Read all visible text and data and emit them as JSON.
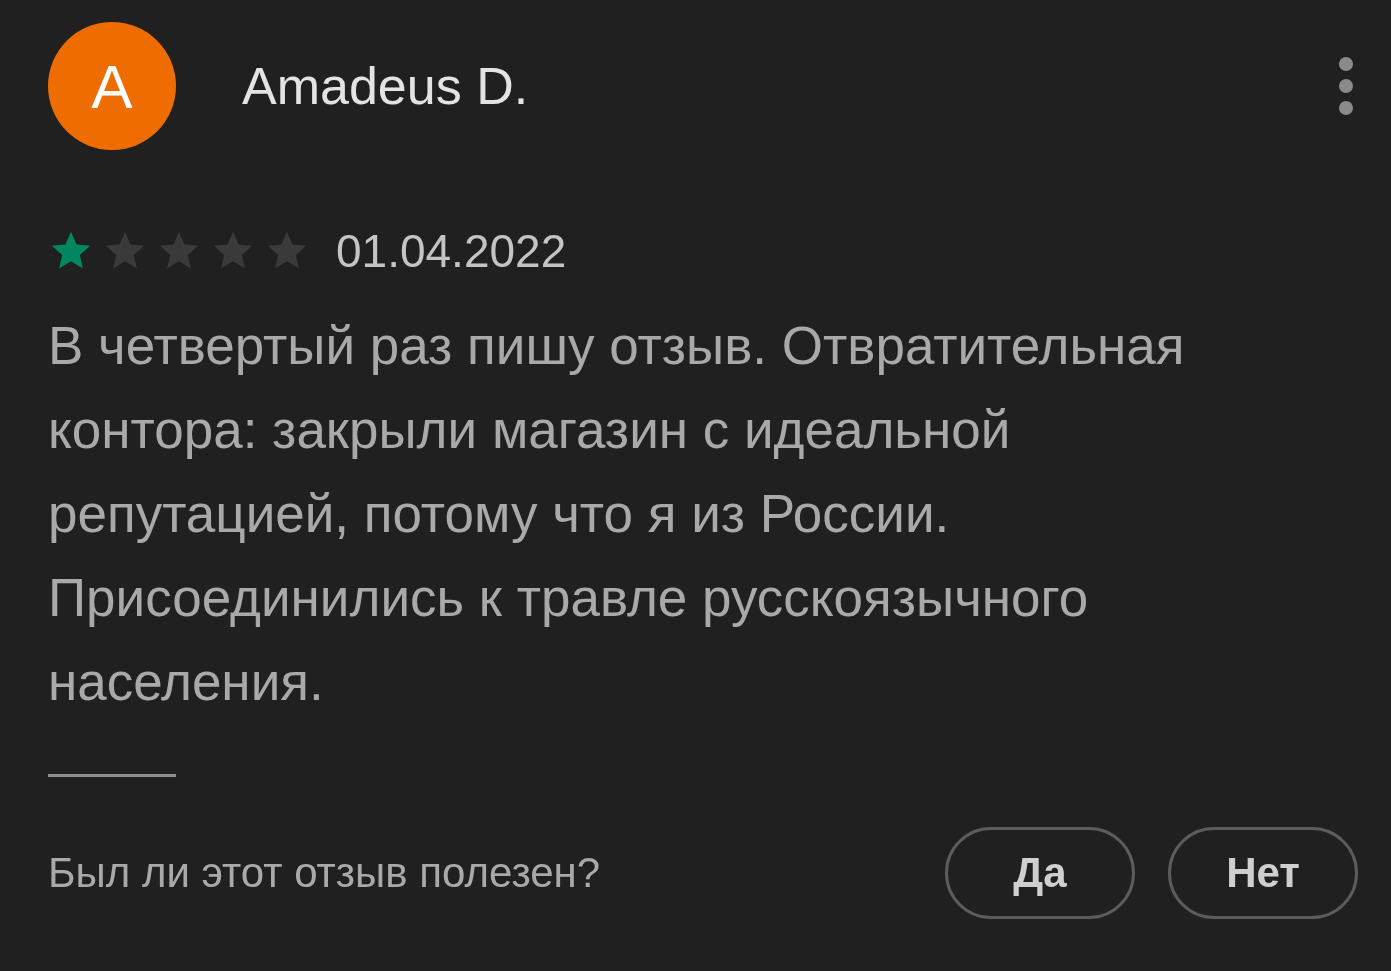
{
  "review": {
    "avatar_letter": "A",
    "author": "Amadeus D.",
    "stars": 1,
    "date": "01.04.2022",
    "text": "В четвертый раз пишу отзыв. Отвратительная контора: закрыли магазин с идеальной репутацией, потому что я из России. Присоединились к травле русскоязычного населения."
  },
  "helpful": {
    "question": "Был ли этот отзыв полезен?",
    "buttons": [
      "Да",
      "Нет"
    ]
  }
}
